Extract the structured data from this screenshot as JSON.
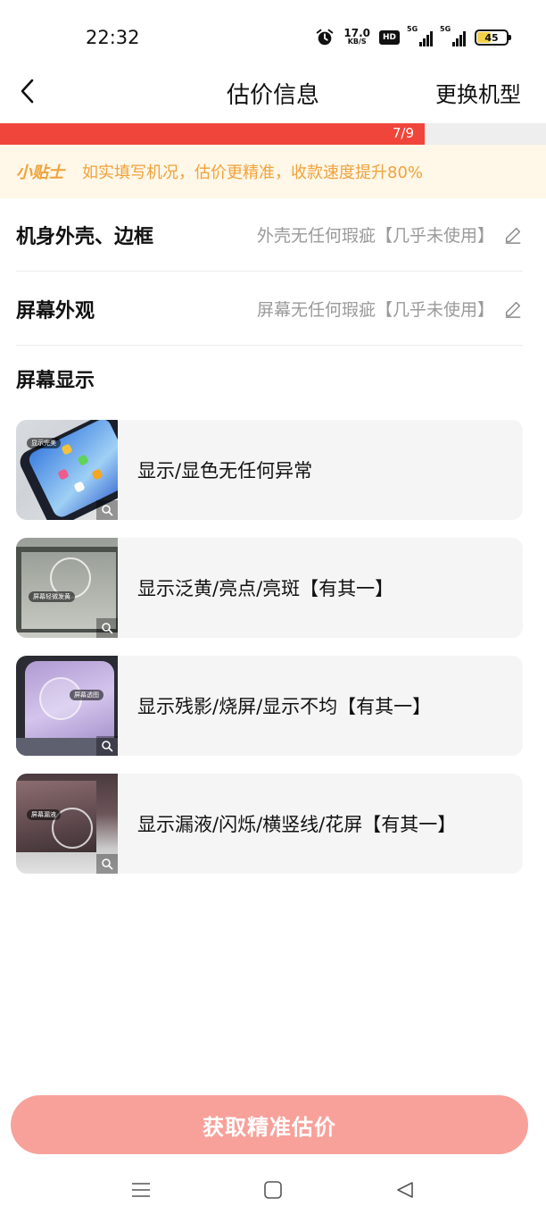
{
  "status_bar": {
    "time": "22:32",
    "net_speed_value": "17.0",
    "net_speed_unit": "KB/S",
    "hd_label": "HD",
    "signal1_label": "5G",
    "signal2_label": "5G",
    "battery_level": "45",
    "icons": [
      "alarm-icon",
      "hd-icon",
      "signal-icon",
      "signal-icon",
      "battery-icon"
    ]
  },
  "nav": {
    "title": "估价信息",
    "right_action": "更换机型",
    "back_icon": "chevron-left-icon"
  },
  "progress": {
    "label": "7/9",
    "current": 7,
    "total": 9,
    "fill_color": "#f0453a"
  },
  "tip": {
    "badge": "小贴士",
    "text": "如实填写机况，估价更精准，收款速度提升80%"
  },
  "answered": [
    {
      "label": "机身外壳、边框",
      "value": "外壳无任何瑕疵【几乎未使用】"
    },
    {
      "label": "屏幕外观",
      "value": "屏幕无任何瑕疵【几乎未使用】"
    }
  ],
  "section_title": "屏幕显示",
  "options": [
    {
      "text": "显示/显色无任何异常",
      "thumb_tag": "显示完美"
    },
    {
      "text": "显示泛黄/亮点/亮斑【有其一】",
      "thumb_tag": "屏幕轻微发黄"
    },
    {
      "text": "显示残影/烧屏/显示不均【有其一】",
      "thumb_tag": "屏幕透图"
    },
    {
      "text": "显示漏液/闪烁/横竖线/花屏【有其一】",
      "thumb_tag": "屏幕漏液"
    }
  ],
  "cta": {
    "label": "获取精准估价",
    "color": "#f8a19a"
  },
  "system_nav": [
    "menu-icon",
    "home-icon",
    "back-icon"
  ]
}
